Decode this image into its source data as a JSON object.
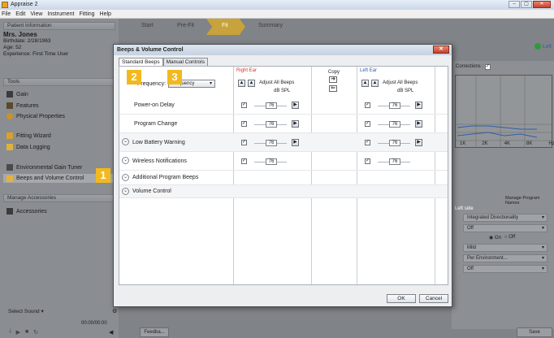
{
  "app": {
    "title": "Appraise 2"
  },
  "menu": [
    "File",
    "Edit",
    "View",
    "Instrument",
    "Fitting",
    "Help"
  ],
  "sidebar": {
    "patient_section": "Patient Information",
    "patient_name": "Mrs. Jones",
    "birthdate": "Birthdate: 2/28/1963",
    "age": "Age: 52",
    "experience": "Experience: First Time User",
    "tools_section": "Tools",
    "tools": [
      "Gain",
      "Features",
      "Physical Properties",
      "Fitting Wizard",
      "Data Logging",
      "Environmental Gain Tuner",
      "Beeps and Volume Control"
    ],
    "accessories_section": "Manage Accessories",
    "accessories": "Accessories",
    "select_sound": "Select Sound",
    "time": "00:00/00:00"
  },
  "topnav": {
    "tabs": [
      "Start",
      "Pre-Fit",
      "Fit",
      "Summary"
    ]
  },
  "right_panel": {
    "corrections": "Corrections :",
    "freq_labels": [
      "1K",
      "2K",
      "4K",
      "8K",
      "Hz"
    ],
    "manage_program_names": "Manage Program Names",
    "left_side": "Left side",
    "directionality": "Integrated Directionality",
    "off1": "Off",
    "on_label": "On",
    "off_label": "Off",
    "mild": "Mild",
    "per_environment": "Per Environment...",
    "off2": "Off",
    "left_label": "Left"
  },
  "footer": {
    "feedback": "Feedba...",
    "save": "Save"
  },
  "dialog": {
    "title": "Beeps & Volume Control",
    "tabs": [
      "Standard Beeps",
      "Manual Controls"
    ],
    "frequency_label": "Frequency:",
    "frequency_value": "Frequency",
    "right_ear": "Right Ear",
    "left_ear": "Left Ear",
    "copy": "Copy",
    "adjust_all": "Adjust All Beeps",
    "db_spl": "dB SPL",
    "rows": [
      {
        "label": "Power-on Delay",
        "right": "76",
        "left": "76"
      },
      {
        "label": "Program Change",
        "right": "76",
        "left": "76"
      },
      {
        "label": "Low Battery Warning",
        "right": "76",
        "left": "76"
      },
      {
        "label": "Wireless Notifications",
        "right": "76",
        "left": "76"
      },
      {
        "label": "Additional Program Beeps"
      },
      {
        "label": "Volume Control"
      }
    ],
    "ok": "OK",
    "cancel": "Cancel"
  },
  "badges": [
    "1",
    "2",
    "3"
  ],
  "colors": {
    "accent": "#F2B91E",
    "right_ear": "#D9352B",
    "left_ear": "#2F5DAA"
  }
}
